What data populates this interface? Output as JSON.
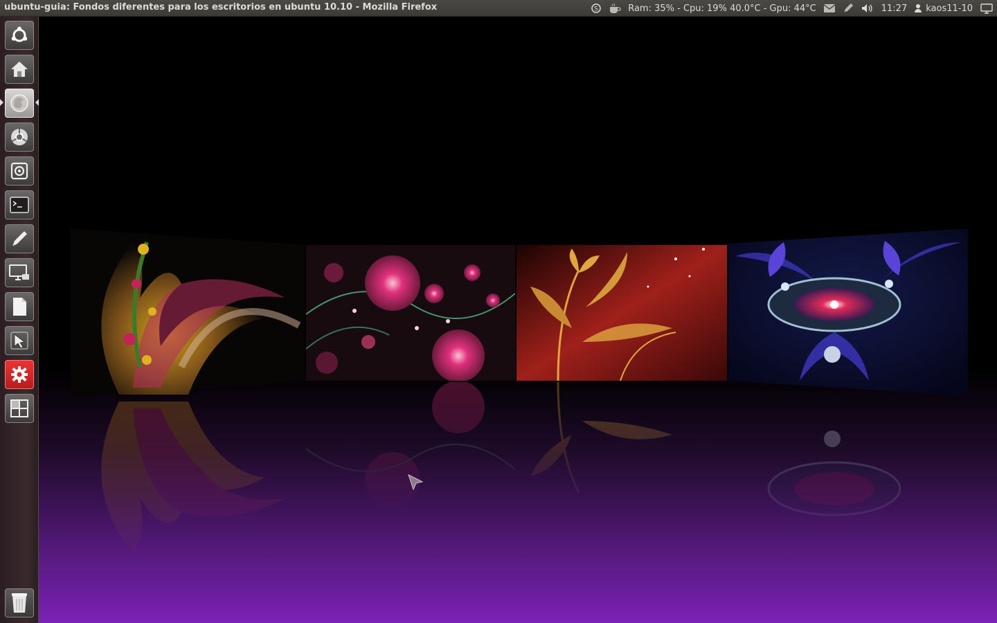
{
  "top_panel": {
    "window_title": "ubuntu-guia: Fondos diferentes para los escritorios en ubuntu 10.10 - Mozilla Firefox",
    "sysmon_text": "Ram: 35% - Cpu: 19% 40.0°C - Gpu: 44°C",
    "clock": "11:27",
    "username": "kaos11-10"
  },
  "launcher": {
    "items": [
      {
        "name": "ubuntu-software-center",
        "icon": "ubuntu-logo-icon"
      },
      {
        "name": "home-folder",
        "icon": "home-icon"
      },
      {
        "name": "firefox",
        "icon": "firefox-icon",
        "running": true,
        "focused": true
      },
      {
        "name": "chrome",
        "icon": "chrome-icon"
      },
      {
        "name": "camera-app",
        "icon": "camera-icon"
      },
      {
        "name": "terminal",
        "icon": "terminal-icon"
      },
      {
        "name": "text-editor",
        "icon": "pen-icon"
      },
      {
        "name": "remote-desktop",
        "icon": "monitor-icon"
      },
      {
        "name": "document",
        "icon": "document-icon"
      },
      {
        "name": "pointer-app",
        "icon": "pointer-icon"
      },
      {
        "name": "settings",
        "icon": "gear-icon"
      },
      {
        "name": "workspace-switcher",
        "icon": "workspaces-icon"
      },
      {
        "name": "trash",
        "icon": "trash-icon"
      }
    ]
  },
  "workspaces": [
    {
      "name": "workspace-1",
      "wallpaper": "fractal-flower-swirl",
      "palette": [
        "#0b0906",
        "#e1b21f",
        "#b22d5d",
        "#3c7a2a"
      ]
    },
    {
      "name": "workspace-2",
      "wallpaper": "fractal-pink-roses",
      "palette": [
        "#170b10",
        "#e0307c",
        "#6c1a3c",
        "#4fb886"
      ]
    },
    {
      "name": "workspace-3",
      "wallpaper": "golden-lilies-red",
      "palette": [
        "#3a0808",
        "#a0201a",
        "#e0a640",
        "#ffffff"
      ]
    },
    {
      "name": "workspace-4",
      "wallpaper": "blue-fractal-lotus",
      "palette": [
        "#05061a",
        "#3c34b8",
        "#e02a5a",
        "#d9e4ff"
      ]
    }
  ],
  "colors": {
    "panel_bg": "#3c3b37",
    "launcher_bg": "#2b1d22",
    "desktop_gradient_bottom": "#7a22b6",
    "accent_red": "#dd2222"
  }
}
